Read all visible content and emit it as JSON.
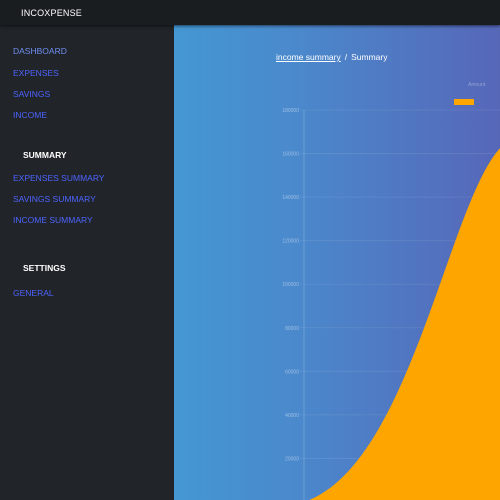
{
  "app": {
    "brand": "INCOXPENSE"
  },
  "sidebar": {
    "nav": [
      {
        "label": "DASHBOARD"
      },
      {
        "label": "EXPENSES"
      },
      {
        "label": "SAVINGS"
      },
      {
        "label": "INCOME"
      }
    ],
    "summary_heading": "SUMMARY",
    "summary_links": [
      {
        "label": "EXPENSES SUMMARY"
      },
      {
        "label": "SAVINGS SUMMARY"
      },
      {
        "label": "INCOME SUMMARY"
      }
    ],
    "settings_heading": "SETTINGS",
    "settings_links": [
      {
        "label": "GENERAL"
      }
    ]
  },
  "breadcrumb": {
    "link": "income summary",
    "separator": "/",
    "current": "Summary"
  },
  "colors": {
    "series": "#ffa500",
    "gradient_start": "#4497d3",
    "gradient_end": "#5667b8",
    "nav_link": "#4d63ff"
  },
  "chart_data": {
    "type": "area",
    "legend": {
      "label": "Amount",
      "position": "top-right"
    },
    "y_ticks": [
      "180000",
      "160000",
      "140000",
      "120000",
      "100000",
      "80000",
      "60000",
      "40000",
      "20000"
    ],
    "ylim": [
      0,
      180000
    ],
    "grid": true,
    "series": [
      {
        "color": "#ffa500",
        "points": [
          {
            "x": 0,
            "y": 0
          },
          {
            "x": 1,
            "y": 166000
          }
        ]
      }
    ]
  }
}
